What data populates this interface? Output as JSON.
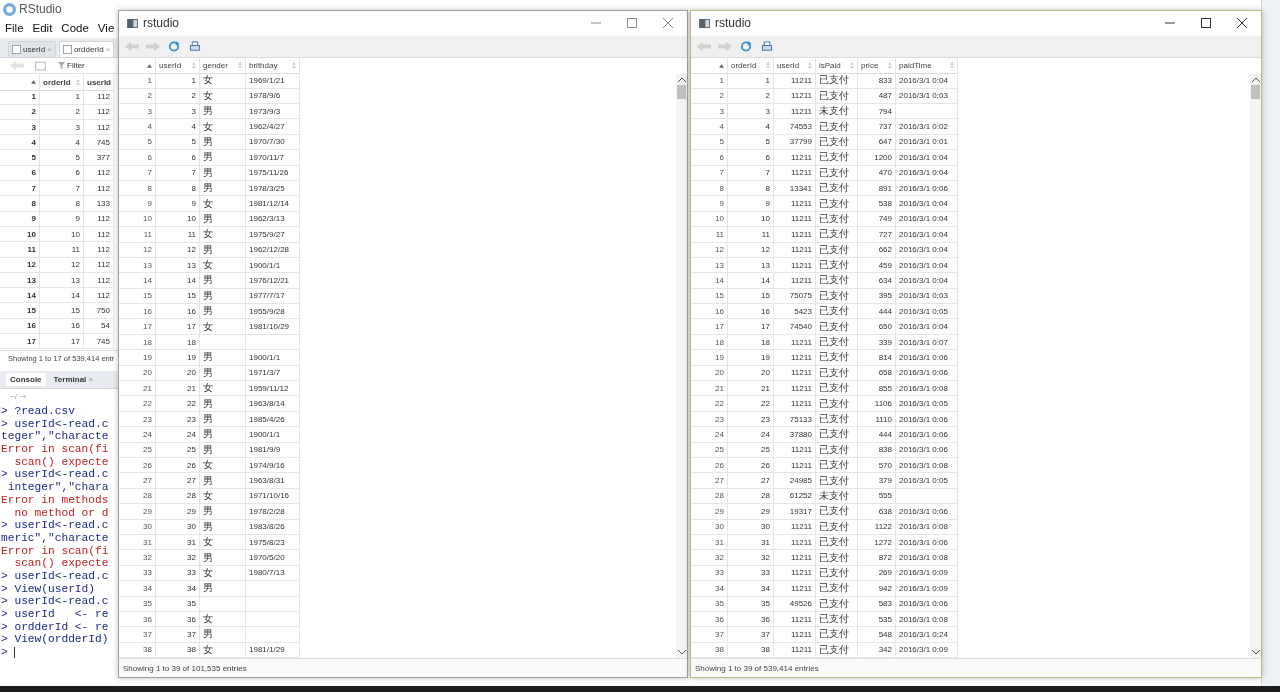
{
  "rstudio": {
    "title": "RStudio",
    "menu": [
      "File",
      "Edit",
      "Code",
      "Vie"
    ],
    "tabs": [
      {
        "label": "userId",
        "close": "×",
        "selected": false
      },
      {
        "label": "ordderId",
        "close": "×",
        "selected": true
      }
    ],
    "filter": "Filter",
    "table": {
      "columns": [
        {
          "kind": "rownames"
        },
        {
          "kind": "data",
          "label": "orderId"
        },
        {
          "kind": "data",
          "label": "userId"
        }
      ],
      "rows": [
        [
          "1",
          "1",
          "112"
        ],
        [
          "2",
          "2",
          "112"
        ],
        [
          "3",
          "3",
          "112"
        ],
        [
          "4",
          "4",
          "745"
        ],
        [
          "5",
          "5",
          "377"
        ],
        [
          "6",
          "6",
          "112"
        ],
        [
          "7",
          "7",
          "112"
        ],
        [
          "8",
          "8",
          "133"
        ],
        [
          "9",
          "9",
          "112"
        ],
        [
          "10",
          "10",
          "112"
        ],
        [
          "11",
          "11",
          "112"
        ],
        [
          "12",
          "12",
          "112"
        ],
        [
          "13",
          "13",
          "112"
        ],
        [
          "14",
          "14",
          "112"
        ],
        [
          "15",
          "15",
          "750"
        ],
        [
          "16",
          "16",
          "54"
        ],
        [
          "17",
          "17",
          "745"
        ]
      ]
    },
    "status": "Showing 1 to 17 of 539,414 entr",
    "console_tabs": [
      {
        "label": "Console",
        "selected": true
      },
      {
        "label": "Terminal",
        "close": "×",
        "selected": false
      }
    ],
    "path": "~/",
    "console_lines": [
      {
        "kind": "input",
        "text": "> ?read.csv"
      },
      {
        "kind": "input",
        "text": "> userId<-read.c"
      },
      {
        "kind": "input",
        "text": "teger\",\"characte"
      },
      {
        "kind": "error",
        "text": "Error in scan(fi"
      },
      {
        "kind": "error",
        "text": "  scan() expecte"
      },
      {
        "kind": "input",
        "text": "> userId<-read.c"
      },
      {
        "kind": "input",
        "text": " integer\",\"chara"
      },
      {
        "kind": "error",
        "text": "Error in methods"
      },
      {
        "kind": "error",
        "text": "  no method or d"
      },
      {
        "kind": "input",
        "text": "> userId<-read.c"
      },
      {
        "kind": "input",
        "text": "meric\",\"characte"
      },
      {
        "kind": "error",
        "text": "Error in scan(fi"
      },
      {
        "kind": "error",
        "text": "  scan() expecte"
      },
      {
        "kind": "input",
        "text": "> userId<-read.c"
      },
      {
        "kind": "input",
        "text": "> View(userId)"
      },
      {
        "kind": "input",
        "text": "> userId<-read.c"
      },
      {
        "kind": "input",
        "text": "> userId   <- re"
      },
      {
        "kind": "input",
        "text": "> ordderId <- re"
      },
      {
        "kind": "input",
        "text": "> View(ordderId)"
      },
      {
        "kind": "prompt",
        "text": ">"
      }
    ]
  },
  "viewer_windows": [
    {
      "title": "rstudio",
      "active": false,
      "columns": [
        {
          "kind": "rownames"
        },
        {
          "kind": "data",
          "label": "userId"
        },
        {
          "kind": "data",
          "label": "gender"
        },
        {
          "kind": "data",
          "label": "brithday"
        }
      ],
      "rows": [
        [
          "1",
          "1",
          "女",
          "1969/1/21"
        ],
        [
          "2",
          "2",
          "女",
          "1978/9/6"
        ],
        [
          "3",
          "3",
          "男",
          "1973/9/3"
        ],
        [
          "4",
          "4",
          "女",
          "1962/4/27"
        ],
        [
          "5",
          "5",
          "男",
          "1970/7/30"
        ],
        [
          "6",
          "6",
          "男",
          "1970/11/7"
        ],
        [
          "7",
          "7",
          "男",
          "1975/11/26"
        ],
        [
          "8",
          "8",
          "男",
          "1978/3/25"
        ],
        [
          "9",
          "9",
          "女",
          "1981/12/14"
        ],
        [
          "10",
          "10",
          "男",
          "1962/3/13"
        ],
        [
          "11",
          "11",
          "女",
          "1975/9/27"
        ],
        [
          "12",
          "12",
          "男",
          "1962/12/28"
        ],
        [
          "13",
          "13",
          "女",
          "1900/1/1"
        ],
        [
          "14",
          "14",
          "男",
          "1976/12/21"
        ],
        [
          "15",
          "15",
          "男",
          "1977/7/17"
        ],
        [
          "16",
          "16",
          "男",
          "1955/9/28"
        ],
        [
          "17",
          "17",
          "女",
          "1981/10/29"
        ],
        [
          "18",
          "18",
          "",
          ""
        ],
        [
          "19",
          "19",
          "男",
          "1900/1/1"
        ],
        [
          "20",
          "20",
          "男",
          "1971/3/7"
        ],
        [
          "21",
          "21",
          "女",
          "1959/11/12"
        ],
        [
          "22",
          "22",
          "男",
          "1963/8/14"
        ],
        [
          "23",
          "23",
          "男",
          "1985/4/26"
        ],
        [
          "24",
          "24",
          "男",
          "1900/1/1"
        ],
        [
          "25",
          "25",
          "男",
          "1981/9/9"
        ],
        [
          "26",
          "26",
          "女",
          "1974/9/16"
        ],
        [
          "27",
          "27",
          "男",
          "1963/8/31"
        ],
        [
          "28",
          "28",
          "女",
          "1971/10/16"
        ],
        [
          "29",
          "29",
          "男",
          "1978/2/28"
        ],
        [
          "30",
          "30",
          "男",
          "1983/8/26"
        ],
        [
          "31",
          "31",
          "女",
          "1975/8/23"
        ],
        [
          "32",
          "32",
          "男",
          "1970/5/20"
        ],
        [
          "33",
          "33",
          "女",
          "1980/7/13"
        ],
        [
          "34",
          "34",
          "男",
          ""
        ],
        [
          "35",
          "35",
          "",
          ""
        ],
        [
          "36",
          "36",
          "女",
          ""
        ],
        [
          "37",
          "37",
          "男",
          ""
        ],
        [
          "38",
          "38",
          "女",
          "1981/1/29"
        ]
      ],
      "status": "Showing 1 to 39 of 101,535 entries"
    },
    {
      "title": "rstudio",
      "active": true,
      "columns": [
        {
          "kind": "rownames"
        },
        {
          "kind": "data",
          "label": "orderId"
        },
        {
          "kind": "data",
          "label": "userId"
        },
        {
          "kind": "data",
          "label": "isPaid"
        },
        {
          "kind": "data",
          "label": "price"
        },
        {
          "kind": "data",
          "label": "paidTime"
        }
      ],
      "rows": [
        [
          "1",
          "1",
          "11211",
          "已支付",
          "833",
          "2016/3/1 0:04"
        ],
        [
          "2",
          "2",
          "11211",
          "已支付",
          "487",
          "2016/3/1 0:03"
        ],
        [
          "3",
          "3",
          "11211",
          "未支付",
          "794",
          ""
        ],
        [
          "4",
          "4",
          "74553",
          "已支付",
          "737",
          "2016/3/1 0:02"
        ],
        [
          "5",
          "5",
          "37799",
          "已支付",
          "647",
          "2016/3/1 0:01"
        ],
        [
          "6",
          "6",
          "11211",
          "已支付",
          "1200",
          "2016/3/1 0:04"
        ],
        [
          "7",
          "7",
          "11211",
          "已支付",
          "470",
          "2016/3/1 0:04"
        ],
        [
          "8",
          "8",
          "13341",
          "已支付",
          "891",
          "2016/3/1 0:06"
        ],
        [
          "9",
          "9",
          "11211",
          "已支付",
          "538",
          "2016/3/1 0:04"
        ],
        [
          "10",
          "10",
          "11211",
          "已支付",
          "749",
          "2016/3/1 0:04"
        ],
        [
          "11",
          "11",
          "11211",
          "已支付",
          "727",
          "2016/3/1 0:04"
        ],
        [
          "12",
          "12",
          "11211",
          "已支付",
          "662",
          "2016/3/1 0:04"
        ],
        [
          "13",
          "13",
          "11211",
          "已支付",
          "459",
          "2016/3/1 0:04"
        ],
        [
          "14",
          "14",
          "11211",
          "已支付",
          "634",
          "2016/3/1 0:04"
        ],
        [
          "15",
          "15",
          "75075",
          "已支付",
          "395",
          "2016/3/1 0:03"
        ],
        [
          "16",
          "16",
          "5423",
          "已支付",
          "444",
          "2016/3/1 0:05"
        ],
        [
          "17",
          "17",
          "74540",
          "已支付",
          "650",
          "2016/3/1 0:04"
        ],
        [
          "18",
          "18",
          "11211",
          "已支付",
          "339",
          "2016/3/1 0:07"
        ],
        [
          "19",
          "19",
          "11211",
          "已支付",
          "814",
          "2016/3/1 0:06"
        ],
        [
          "20",
          "20",
          "11211",
          "已支付",
          "658",
          "2016/3/1 0:06"
        ],
        [
          "21",
          "21",
          "11211",
          "已支付",
          "855",
          "2016/3/1 0:08"
        ],
        [
          "22",
          "22",
          "11211",
          "已支付",
          "1106",
          "2016/3/1 0:05"
        ],
        [
          "23",
          "23",
          "75133",
          "已支付",
          "1110",
          "2016/3/1 0:06"
        ],
        [
          "24",
          "24",
          "37880",
          "已支付",
          "444",
          "2016/3/1 0:06"
        ],
        [
          "25",
          "25",
          "11211",
          "已支付",
          "838",
          "2016/3/1 0:06"
        ],
        [
          "26",
          "26",
          "11211",
          "已支付",
          "570",
          "2016/3/1 0:08"
        ],
        [
          "27",
          "27",
          "24985",
          "已支付",
          "379",
          "2016/3/1 0:05"
        ],
        [
          "28",
          "28",
          "61252",
          "未支付",
          "555",
          ""
        ],
        [
          "29",
          "29",
          "19317",
          "已支付",
          "638",
          "2016/3/1 0:06"
        ],
        [
          "30",
          "30",
          "11211",
          "已支付",
          "1122",
          "2016/3/1 0:08"
        ],
        [
          "31",
          "31",
          "11211",
          "已支付",
          "1272",
          "2016/3/1 0:06"
        ],
        [
          "32",
          "32",
          "11211",
          "已支付",
          "872",
          "2016/3/1 0:08"
        ],
        [
          "33",
          "33",
          "11211",
          "已支付",
          "269",
          "2016/3/1 0:09"
        ],
        [
          "34",
          "34",
          "11211",
          "已支付",
          "942",
          "2016/3/1 0:09"
        ],
        [
          "35",
          "35",
          "49526",
          "已支付",
          "583",
          "2016/3/1 0:06"
        ],
        [
          "36",
          "36",
          "11211",
          "已支付",
          "535",
          "2016/3/1 0:08"
        ],
        [
          "37",
          "37",
          "11211",
          "已支付",
          "548",
          "2016/3/1 0:24"
        ],
        [
          "38",
          "38",
          "11211",
          "已支付",
          "342",
          "2016/3/1 0:09"
        ]
      ],
      "status": "Showing 1 to 39 of 539,414 entries"
    }
  ]
}
